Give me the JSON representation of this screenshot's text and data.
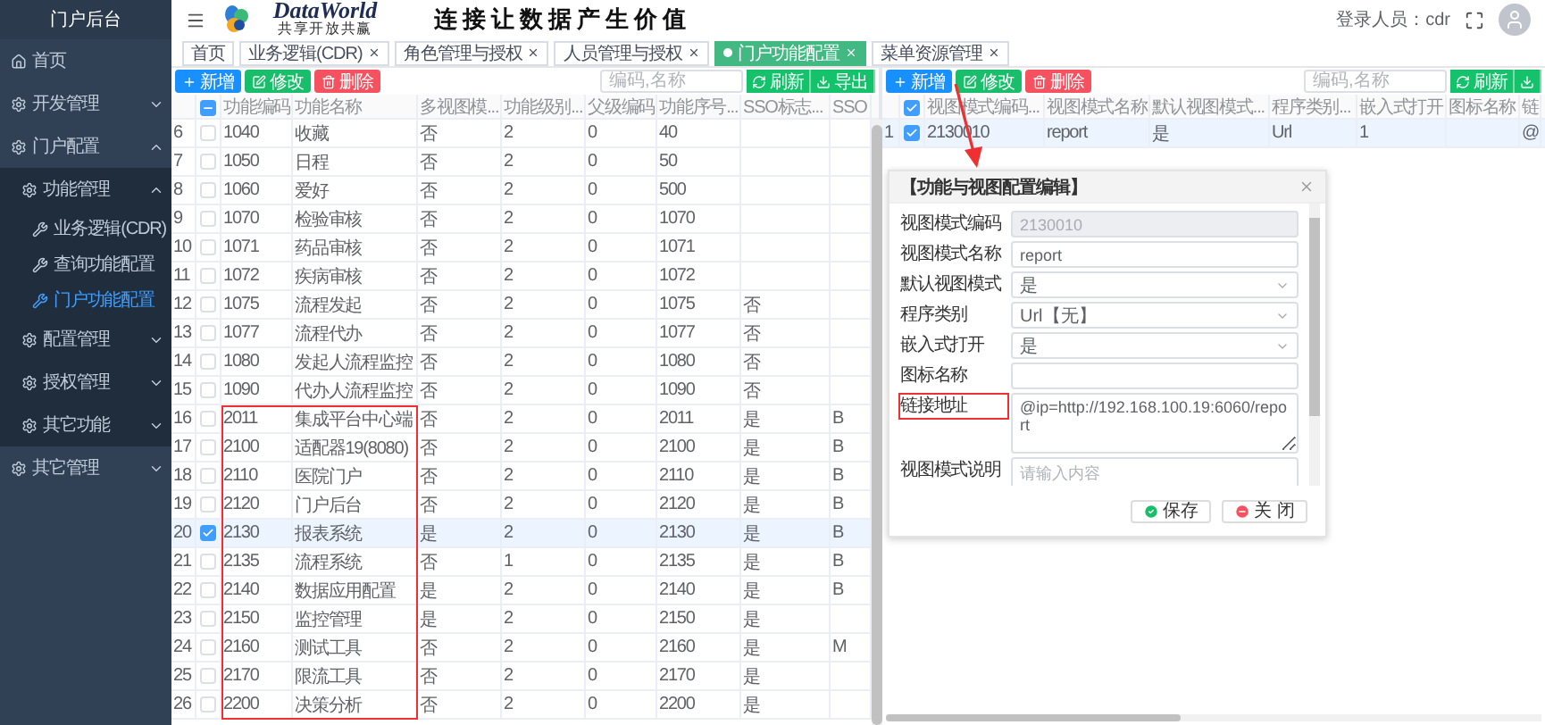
{
  "sidebar": {
    "title": "门户后台",
    "items": [
      {
        "label": "首页",
        "kind": "home",
        "selected": false
      },
      {
        "label": "开发管理",
        "kind": "group",
        "selected": false,
        "expanded": false
      },
      {
        "label": "门户配置",
        "kind": "group",
        "selected": false,
        "expanded": true,
        "children": [
          {
            "label": "功能管理",
            "kind": "group",
            "selected": false,
            "expanded": true,
            "children": [
              {
                "label": "业务逻辑(CDR)",
                "kind": "page",
                "selected": false
              },
              {
                "label": "查询功能配置",
                "kind": "page",
                "selected": false
              },
              {
                "label": "门户功能配置",
                "kind": "page",
                "selected": true
              }
            ]
          },
          {
            "label": "配置管理",
            "kind": "group",
            "selected": false,
            "expanded": false
          },
          {
            "label": "授权管理",
            "kind": "group",
            "selected": false,
            "expanded": false
          },
          {
            "label": "其它功能",
            "kind": "group",
            "selected": false,
            "expanded": false
          }
        ]
      },
      {
        "label": "其它管理",
        "kind": "group",
        "selected": false,
        "expanded": false
      }
    ]
  },
  "header": {
    "brand": "DataWorld",
    "tagline": "共享开放共赢",
    "slogan": "连接让数据产生价值",
    "user": "登录人员：cdr"
  },
  "tabs": [
    {
      "label": "首页",
      "selected": false,
      "closable": false
    },
    {
      "label": "业务逻辑(CDR)",
      "selected": false,
      "closable": true
    },
    {
      "label": "角色管理与授权",
      "selected": false,
      "closable": true
    },
    {
      "label": "人员管理与授权",
      "selected": false,
      "closable": true
    },
    {
      "label": "门户功能配置",
      "selected": true,
      "closable": true
    },
    {
      "label": "菜单资源管理",
      "selected": false,
      "closable": true
    }
  ],
  "left_panel": {
    "actions": [
      {
        "kind": "add",
        "label": "新增"
      },
      {
        "kind": "edit",
        "label": "修改"
      },
      {
        "kind": "delete",
        "label": "删除"
      }
    ],
    "search": {
      "placeholder": "编码,名称"
    },
    "tools": [
      {
        "kind": "refresh",
        "label": "刷新"
      },
      {
        "kind": "export",
        "label": "导出"
      }
    ],
    "table": {
      "indeterminate": true,
      "columns": [
        "功能编码",
        "功能名称",
        "多视图模...",
        "功能级别...",
        "父级编码",
        "功能序号...",
        "SSO标志...",
        "SSO"
      ],
      "rows": [
        {
          "no": "6",
          "checked": false,
          "boxed": false,
          "cells": [
            "1040",
            "收藏",
            "否",
            "2",
            "0",
            "40",
            null,
            null
          ]
        },
        {
          "no": "7",
          "checked": false,
          "boxed": false,
          "cells": [
            "1050",
            "日程",
            "否",
            "2",
            "0",
            "50",
            null,
            null
          ]
        },
        {
          "no": "8",
          "checked": false,
          "boxed": false,
          "cells": [
            "1060",
            "爱好",
            "否",
            "2",
            "0",
            "500",
            null,
            null
          ]
        },
        {
          "no": "9",
          "checked": false,
          "boxed": false,
          "cells": [
            "1070",
            "检验审核",
            "否",
            "2",
            "0",
            "1070",
            null,
            null
          ]
        },
        {
          "no": "10",
          "checked": false,
          "boxed": false,
          "cells": [
            "1071",
            "药品审核",
            "否",
            "2",
            "0",
            "1071",
            null,
            null
          ]
        },
        {
          "no": "11",
          "checked": false,
          "boxed": false,
          "cells": [
            "1072",
            "疾病审核",
            "否",
            "2",
            "0",
            "1072",
            null,
            null
          ]
        },
        {
          "no": "12",
          "checked": false,
          "boxed": false,
          "cells": [
            "1075",
            "流程发起",
            "否",
            "2",
            "0",
            "1075",
            "否",
            null
          ]
        },
        {
          "no": "13",
          "checked": false,
          "boxed": false,
          "cells": [
            "1077",
            "流程代办",
            "否",
            "2",
            "0",
            "1077",
            "否",
            null
          ]
        },
        {
          "no": "14",
          "checked": false,
          "boxed": false,
          "cells": [
            "1080",
            "发起人流程监控",
            "否",
            "2",
            "0",
            "1080",
            "否",
            null
          ]
        },
        {
          "no": "15",
          "checked": false,
          "boxed": false,
          "cells": [
            "1090",
            "代办人流程监控",
            "否",
            "2",
            "0",
            "1090",
            "否",
            null
          ]
        },
        {
          "no": "16",
          "checked": false,
          "boxed": true,
          "cells": [
            "2011",
            "集成平台中心端",
            "否",
            "2",
            "0",
            "2011",
            "是",
            "B"
          ]
        },
        {
          "no": "17",
          "checked": false,
          "boxed": true,
          "cells": [
            "2100",
            "适配器19(8080)",
            "否",
            "2",
            "0",
            "2100",
            "是",
            "B"
          ]
        },
        {
          "no": "18",
          "checked": false,
          "boxed": true,
          "cells": [
            "2110",
            "医院门户",
            "否",
            "2",
            "0",
            "2110",
            "是",
            "B"
          ]
        },
        {
          "no": "19",
          "checked": false,
          "boxed": true,
          "cells": [
            "2120",
            "门户后台",
            "否",
            "2",
            "0",
            "2120",
            "是",
            "B"
          ]
        },
        {
          "no": "20",
          "checked": true,
          "boxed": true,
          "cells": [
            "2130",
            "报表系统",
            "是",
            "2",
            "0",
            "2130",
            "是",
            "B"
          ]
        },
        {
          "no": "21",
          "checked": false,
          "boxed": true,
          "cells": [
            "2135",
            "流程系统",
            "否",
            "1",
            "0",
            "2135",
            "是",
            "B"
          ]
        },
        {
          "no": "22",
          "checked": false,
          "boxed": true,
          "cells": [
            "2140",
            "数据应用配置",
            "是",
            "2",
            "0",
            "2140",
            "是",
            "B"
          ]
        },
        {
          "no": "23",
          "checked": false,
          "boxed": true,
          "cells": [
            "2150",
            "监控管理",
            "是",
            "2",
            "0",
            "2150",
            "是",
            null
          ]
        },
        {
          "no": "24",
          "checked": false,
          "boxed": true,
          "cells": [
            "2160",
            "测试工具",
            "否",
            "2",
            "0",
            "2160",
            "是",
            "M"
          ]
        },
        {
          "no": "25",
          "checked": false,
          "boxed": true,
          "cells": [
            "2170",
            "限流工具",
            "否",
            "2",
            "0",
            "2170",
            "是",
            null
          ]
        },
        {
          "no": "26",
          "checked": false,
          "boxed": true,
          "cells": [
            "2200",
            "决策分析",
            "否",
            "2",
            "0",
            "2200",
            "是",
            null
          ]
        }
      ]
    }
  },
  "right_panel": {
    "actions": [
      {
        "kind": "add",
        "label": "新增"
      },
      {
        "kind": "edit",
        "label": "修改"
      },
      {
        "kind": "delete",
        "label": "删除"
      }
    ],
    "search": {
      "placeholder": "编码,名称"
    },
    "tools": [
      {
        "kind": "refresh",
        "label": "刷新"
      },
      {
        "kind": "export"
      }
    ],
    "table": {
      "all_checked": true,
      "columns": [
        "视图模式编码...",
        "视图模式名称",
        "默认视图模式...",
        "程序类别...",
        "嵌入式打开",
        "图标名称",
        "链"
      ],
      "rows": [
        {
          "no": "1",
          "checked": true,
          "cells": [
            "2130010",
            "report",
            "是",
            "Url",
            "1",
            null,
            "@"
          ]
        }
      ]
    },
    "dialog": {
      "title": "【功能与视图配置编辑】",
      "fields": [
        {
          "label": "视图模式编码",
          "kind": "input",
          "value": "2130010",
          "disabled": true,
          "boxed": false
        },
        {
          "label": "视图模式名称",
          "kind": "input",
          "value": "report",
          "disabled": false,
          "boxed": false
        },
        {
          "label": "默认视图模式",
          "kind": "select",
          "value": "是",
          "disabled": false,
          "boxed": false
        },
        {
          "label": "程序类别",
          "kind": "select",
          "value": "Url【无】",
          "disabled": false,
          "boxed": false
        },
        {
          "label": "嵌入式打开",
          "kind": "select",
          "value": "是",
          "disabled": false,
          "boxed": false
        },
        {
          "label": "图标名称",
          "kind": "input",
          "disabled": false,
          "boxed": false
        },
        {
          "label": "链接地址",
          "kind": "textarea",
          "value": "@ip=http://192.168.100.19:6060/report",
          "disabled": false,
          "boxed": true
        },
        {
          "label": "视图模式说明",
          "kind": "textarea",
          "placeholder": "请输入内容",
          "disabled": false,
          "boxed": false
        }
      ],
      "buttons": [
        {
          "kind": "save",
          "label": "保存"
        },
        {
          "kind": "close",
          "label": "关 闭"
        }
      ]
    }
  }
}
